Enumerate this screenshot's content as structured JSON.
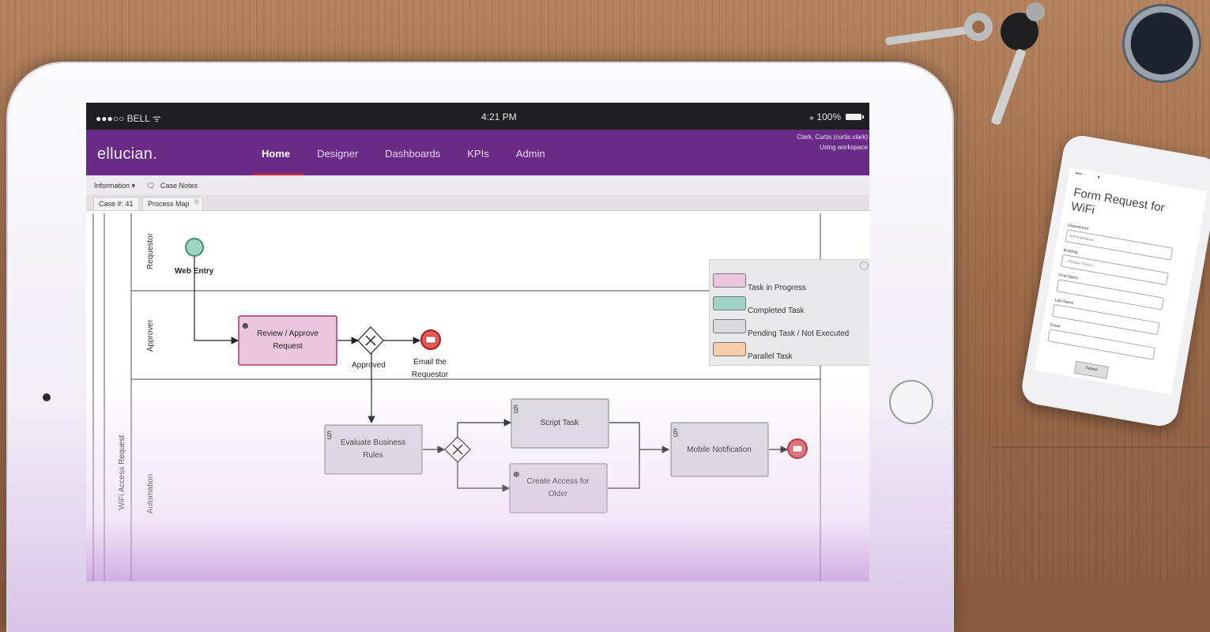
{
  "statusbar": {
    "carrier": "●●●○○ BELL ᯤ",
    "time": "4:21 PM",
    "battery": "⁎ 100%"
  },
  "navbar": {
    "brand": "ellucian.",
    "items": [
      {
        "label": "Home"
      },
      {
        "label": "Designer"
      },
      {
        "label": "Dashboards"
      },
      {
        "label": "KPIs"
      },
      {
        "label": "Admin"
      }
    ],
    "user_name": "Clark, Curtis (curtis.clark)",
    "workspace": "Using workspace"
  },
  "toolbar": {
    "information": "Information ▾",
    "case_notes": "Case Notes"
  },
  "tabs": [
    {
      "label": "Case #: 41"
    },
    {
      "label": "Process Map"
    }
  ],
  "diagram": {
    "pool": "WiFi Access Request",
    "lanes": [
      "Requestor",
      "Approver",
      "Automation"
    ],
    "nodes": {
      "web_entry": "Web Entry",
      "review_line1": "Review / Approve",
      "review_line2": "Request",
      "approved": "Approved",
      "email_line1": "Email the",
      "email_line2": "Requestor",
      "evaluate_line1": "Evaluate Business",
      "evaluate_line2": "Rules",
      "script_task": "Script Task",
      "create_line1": "Create Access for",
      "create_line2": "Older",
      "mobile_notification": "Mobile Notification"
    }
  },
  "legend": [
    {
      "label": "Task in Progress",
      "color": "#ecc6dd"
    },
    {
      "label": "Completed Task",
      "color": "#9fd3c3"
    },
    {
      "label": "Pending Task / Not Executed",
      "color": "#dcdcdf"
    },
    {
      "label": "Parallel Task",
      "color": "#f6ccaa"
    }
  ],
  "phone": {
    "title": "Form Request for WiFi",
    "fields": [
      {
        "label": "Department",
        "value": "Administration"
      },
      {
        "label": "Building",
        "value": "-- Please Select --"
      },
      {
        "label": "First Name",
        "value": ""
      },
      {
        "label": "Last Name",
        "value": ""
      },
      {
        "label": "Email",
        "value": ""
      }
    ],
    "submit": "Submit"
  }
}
